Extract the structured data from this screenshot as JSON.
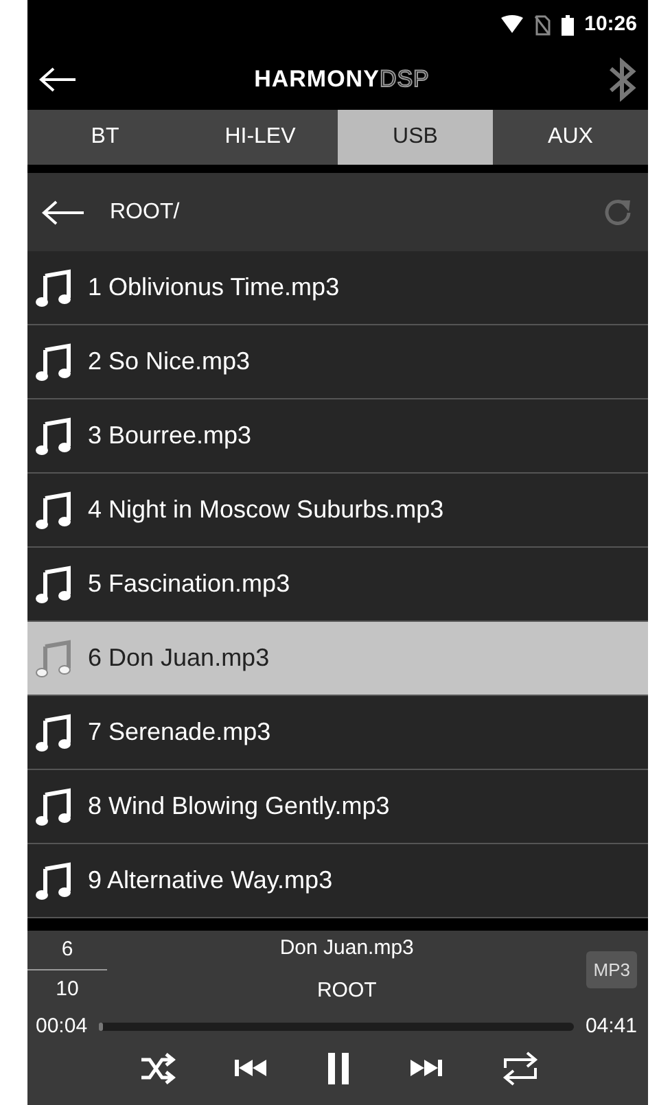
{
  "status_bar": {
    "time": "10:26"
  },
  "header": {
    "logo_main": "HARMONY",
    "logo_suffix": "DSP"
  },
  "tabs": [
    {
      "label": "BT",
      "selected": false
    },
    {
      "label": "HI-LEV",
      "selected": false
    },
    {
      "label": "USB",
      "selected": true
    },
    {
      "label": "AUX",
      "selected": false
    }
  ],
  "path_bar": {
    "path": "ROOT/"
  },
  "files": [
    {
      "name": "1 Oblivionus Time.mp3",
      "selected": false
    },
    {
      "name": "2 So Nice.mp3",
      "selected": false
    },
    {
      "name": "3 Bourree.mp3",
      "selected": false
    },
    {
      "name": "4 Night in Moscow Suburbs.mp3",
      "selected": false
    },
    {
      "name": "5 Fascination.mp3",
      "selected": false
    },
    {
      "name": "6 Don Juan.mp3",
      "selected": true
    },
    {
      "name": "7 Serenade.mp3",
      "selected": false
    },
    {
      "name": "8 Wind Blowing Gently.mp3",
      "selected": false
    },
    {
      "name": "9 Alternative Way.mp3",
      "selected": false
    }
  ],
  "player": {
    "track_number": "6",
    "track_total": "10",
    "title": "Don Juan.mp3",
    "folder": "ROOT",
    "format": "MP3",
    "elapsed": "00:04",
    "duration": "04:41",
    "level": 0.01
  }
}
